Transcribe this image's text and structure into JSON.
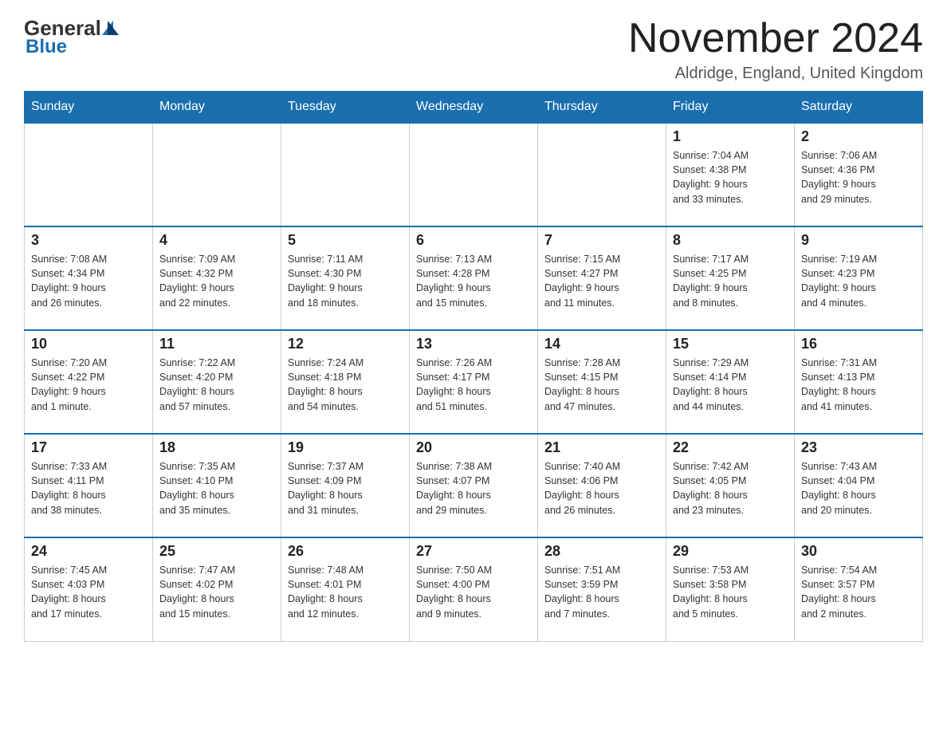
{
  "header": {
    "logo_general": "General",
    "logo_blue": "Blue",
    "month_title": "November 2024",
    "location": "Aldridge, England, United Kingdom"
  },
  "days_of_week": [
    "Sunday",
    "Monday",
    "Tuesday",
    "Wednesday",
    "Thursday",
    "Friday",
    "Saturday"
  ],
  "weeks": [
    [
      {
        "day": "",
        "info": ""
      },
      {
        "day": "",
        "info": ""
      },
      {
        "day": "",
        "info": ""
      },
      {
        "day": "",
        "info": ""
      },
      {
        "day": "",
        "info": ""
      },
      {
        "day": "1",
        "info": "Sunrise: 7:04 AM\nSunset: 4:38 PM\nDaylight: 9 hours\nand 33 minutes."
      },
      {
        "day": "2",
        "info": "Sunrise: 7:06 AM\nSunset: 4:36 PM\nDaylight: 9 hours\nand 29 minutes."
      }
    ],
    [
      {
        "day": "3",
        "info": "Sunrise: 7:08 AM\nSunset: 4:34 PM\nDaylight: 9 hours\nand 26 minutes."
      },
      {
        "day": "4",
        "info": "Sunrise: 7:09 AM\nSunset: 4:32 PM\nDaylight: 9 hours\nand 22 minutes."
      },
      {
        "day": "5",
        "info": "Sunrise: 7:11 AM\nSunset: 4:30 PM\nDaylight: 9 hours\nand 18 minutes."
      },
      {
        "day": "6",
        "info": "Sunrise: 7:13 AM\nSunset: 4:28 PM\nDaylight: 9 hours\nand 15 minutes."
      },
      {
        "day": "7",
        "info": "Sunrise: 7:15 AM\nSunset: 4:27 PM\nDaylight: 9 hours\nand 11 minutes."
      },
      {
        "day": "8",
        "info": "Sunrise: 7:17 AM\nSunset: 4:25 PM\nDaylight: 9 hours\nand 8 minutes."
      },
      {
        "day": "9",
        "info": "Sunrise: 7:19 AM\nSunset: 4:23 PM\nDaylight: 9 hours\nand 4 minutes."
      }
    ],
    [
      {
        "day": "10",
        "info": "Sunrise: 7:20 AM\nSunset: 4:22 PM\nDaylight: 9 hours\nand 1 minute."
      },
      {
        "day": "11",
        "info": "Sunrise: 7:22 AM\nSunset: 4:20 PM\nDaylight: 8 hours\nand 57 minutes."
      },
      {
        "day": "12",
        "info": "Sunrise: 7:24 AM\nSunset: 4:18 PM\nDaylight: 8 hours\nand 54 minutes."
      },
      {
        "day": "13",
        "info": "Sunrise: 7:26 AM\nSunset: 4:17 PM\nDaylight: 8 hours\nand 51 minutes."
      },
      {
        "day": "14",
        "info": "Sunrise: 7:28 AM\nSunset: 4:15 PM\nDaylight: 8 hours\nand 47 minutes."
      },
      {
        "day": "15",
        "info": "Sunrise: 7:29 AM\nSunset: 4:14 PM\nDaylight: 8 hours\nand 44 minutes."
      },
      {
        "day": "16",
        "info": "Sunrise: 7:31 AM\nSunset: 4:13 PM\nDaylight: 8 hours\nand 41 minutes."
      }
    ],
    [
      {
        "day": "17",
        "info": "Sunrise: 7:33 AM\nSunset: 4:11 PM\nDaylight: 8 hours\nand 38 minutes."
      },
      {
        "day": "18",
        "info": "Sunrise: 7:35 AM\nSunset: 4:10 PM\nDaylight: 8 hours\nand 35 minutes."
      },
      {
        "day": "19",
        "info": "Sunrise: 7:37 AM\nSunset: 4:09 PM\nDaylight: 8 hours\nand 31 minutes."
      },
      {
        "day": "20",
        "info": "Sunrise: 7:38 AM\nSunset: 4:07 PM\nDaylight: 8 hours\nand 29 minutes."
      },
      {
        "day": "21",
        "info": "Sunrise: 7:40 AM\nSunset: 4:06 PM\nDaylight: 8 hours\nand 26 minutes."
      },
      {
        "day": "22",
        "info": "Sunrise: 7:42 AM\nSunset: 4:05 PM\nDaylight: 8 hours\nand 23 minutes."
      },
      {
        "day": "23",
        "info": "Sunrise: 7:43 AM\nSunset: 4:04 PM\nDaylight: 8 hours\nand 20 minutes."
      }
    ],
    [
      {
        "day": "24",
        "info": "Sunrise: 7:45 AM\nSunset: 4:03 PM\nDaylight: 8 hours\nand 17 minutes."
      },
      {
        "day": "25",
        "info": "Sunrise: 7:47 AM\nSunset: 4:02 PM\nDaylight: 8 hours\nand 15 minutes."
      },
      {
        "day": "26",
        "info": "Sunrise: 7:48 AM\nSunset: 4:01 PM\nDaylight: 8 hours\nand 12 minutes."
      },
      {
        "day": "27",
        "info": "Sunrise: 7:50 AM\nSunset: 4:00 PM\nDaylight: 8 hours\nand 9 minutes."
      },
      {
        "day": "28",
        "info": "Sunrise: 7:51 AM\nSunset: 3:59 PM\nDaylight: 8 hours\nand 7 minutes."
      },
      {
        "day": "29",
        "info": "Sunrise: 7:53 AM\nSunset: 3:58 PM\nDaylight: 8 hours\nand 5 minutes."
      },
      {
        "day": "30",
        "info": "Sunrise: 7:54 AM\nSunset: 3:57 PM\nDaylight: 8 hours\nand 2 minutes."
      }
    ]
  ]
}
